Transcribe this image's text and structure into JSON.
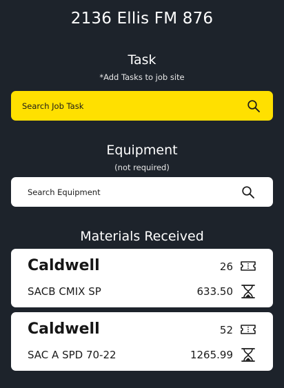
{
  "header": {
    "title": "2136 Ellis FM 876"
  },
  "task": {
    "heading": "Task",
    "subheading": "*Add Tasks to job site",
    "search_placeholder": "Search Job Task"
  },
  "equipment": {
    "heading": "Equipment",
    "subheading": "(not required)",
    "search_placeholder": "Search Equipment"
  },
  "materials": {
    "heading": "Materials Received",
    "items": [
      {
        "supplier": "Caldwell",
        "ticket_count": "26",
        "product": "SACB CMIX SP",
        "quantity": "633.50"
      },
      {
        "supplier": "Caldwell",
        "ticket_count": "52",
        "product": "SAC A SPD 70-22",
        "quantity": "1265.99"
      }
    ]
  },
  "icons": {
    "search": "search-icon",
    "ticket": "ticket-icon",
    "quantity": "hourglass-icon"
  },
  "colors": {
    "background": "#1d232b",
    "accent": "#ffe000",
    "card": "#ffffff"
  }
}
